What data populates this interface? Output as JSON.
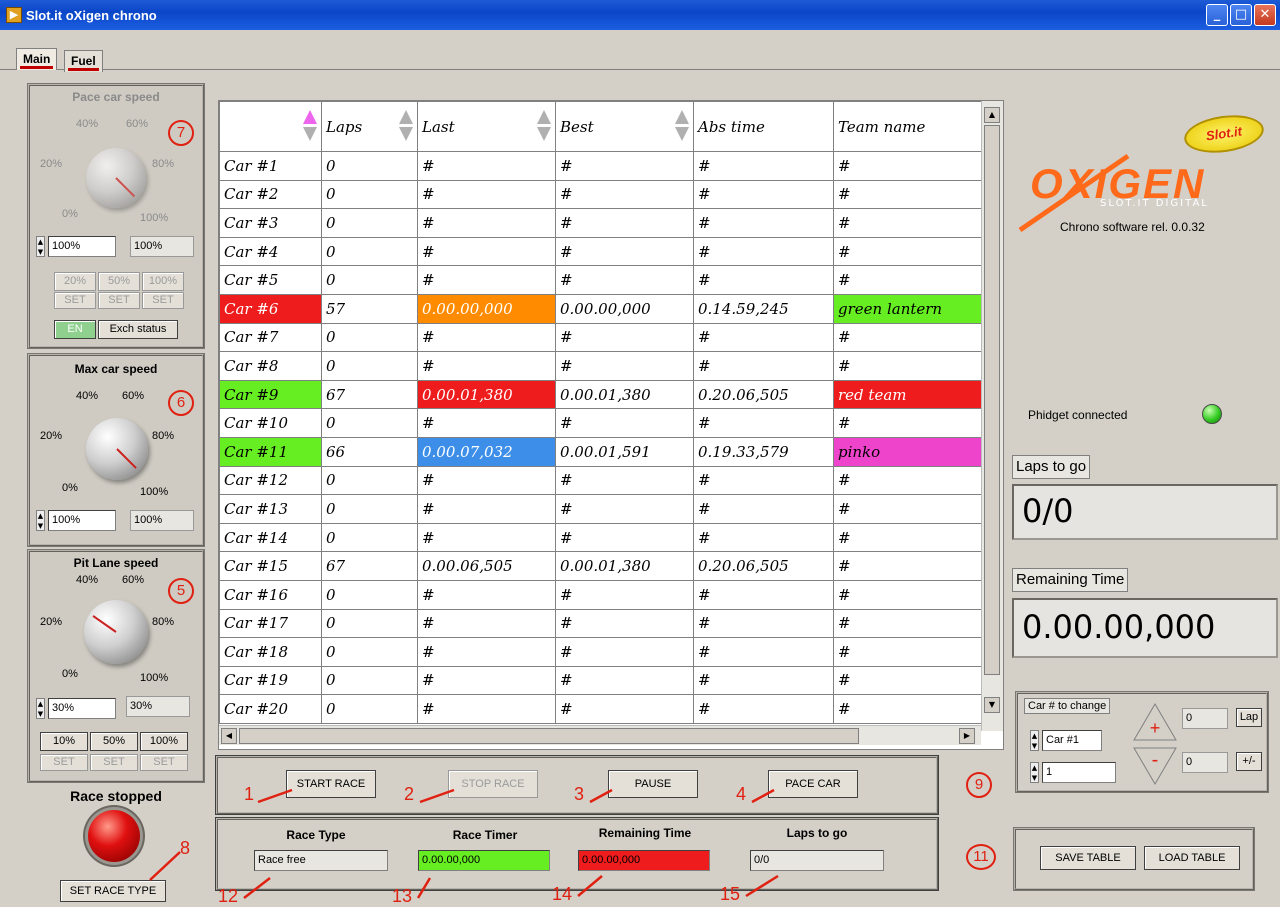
{
  "window": {
    "title": "Slot.it oXigen chrono",
    "icon": "app-icon",
    "controls": [
      "minimize-icon",
      "maximize-icon",
      "close-icon"
    ]
  },
  "tabs": [
    {
      "label": "Main",
      "selected": true
    },
    {
      "label": "Fuel",
      "selected": false
    }
  ],
  "pace_car": {
    "title": "Pace car speed",
    "scale": {
      "p0": "0%",
      "p20": "20%",
      "p40": "40%",
      "p60": "60%",
      "p80": "80%",
      "p100": "100%"
    },
    "value": "100%",
    "readout": "100%",
    "presets": [
      {
        "pct": "20%",
        "set": "SET"
      },
      {
        "pct": "50%",
        "set": "SET"
      },
      {
        "pct": "100%",
        "set": "SET"
      }
    ],
    "en_label": "EN",
    "exch_label": "Exch status",
    "marker": "7",
    "knob_level": 1.0
  },
  "max_car": {
    "title": "Max car speed",
    "scale": {
      "p0": "0%",
      "p20": "20%",
      "p40": "40%",
      "p60": "60%",
      "p80": "80%",
      "p100": "100%"
    },
    "value": "100%",
    "readout": "100%",
    "marker": "6",
    "knob_level": 1.0
  },
  "pit_lane": {
    "title": "Pit Lane speed",
    "scale": {
      "p0": "0%",
      "p20": "20%",
      "p40": "40%",
      "p60": "60%",
      "p80": "80%",
      "p100": "100%"
    },
    "value": "30%",
    "readout": "30%",
    "presets": [
      {
        "pct": "10%",
        "set": "SET"
      },
      {
        "pct": "50%",
        "set": "SET"
      },
      {
        "pct": "100%",
        "set": "SET"
      }
    ],
    "marker": "5",
    "knob_level": 0.3
  },
  "race_status": {
    "label": "Race stopped",
    "led_color": "#e01010",
    "set_race_type_label": "SET RACE TYPE",
    "marker": "8"
  },
  "table": {
    "columns": [
      "",
      "Laps",
      "Last",
      "Best",
      "Abs time",
      "Team name"
    ],
    "rows": [
      {
        "car": "Car #1",
        "laps": "0",
        "last": "#",
        "best": "#",
        "abs": "#",
        "team": "#",
        "car_bg": "",
        "last_bg": "",
        "team_bg": ""
      },
      {
        "car": "Car #2",
        "laps": "0",
        "last": "#",
        "best": "#",
        "abs": "#",
        "team": "#",
        "car_bg": "",
        "last_bg": "",
        "team_bg": ""
      },
      {
        "car": "Car #3",
        "laps": "0",
        "last": "#",
        "best": "#",
        "abs": "#",
        "team": "#",
        "car_bg": "",
        "last_bg": "",
        "team_bg": ""
      },
      {
        "car": "Car #4",
        "laps": "0",
        "last": "#",
        "best": "#",
        "abs": "#",
        "team": "#",
        "car_bg": "",
        "last_bg": "",
        "team_bg": ""
      },
      {
        "car": "Car #5",
        "laps": "0",
        "last": "#",
        "best": "#",
        "abs": "#",
        "team": "#",
        "car_bg": "",
        "last_bg": "",
        "team_bg": ""
      },
      {
        "car": "Car #6",
        "laps": "57",
        "last": "0.00.00,000",
        "best": "0.00.00,000",
        "abs": "0.14.59,245",
        "team": "green lantern",
        "car_bg": "#ee1c1c",
        "last_bg": "#ff8c00",
        "team_bg": "#66ee22"
      },
      {
        "car": "Car #7",
        "laps": "0",
        "last": "#",
        "best": "#",
        "abs": "#",
        "team": "#",
        "car_bg": "",
        "last_bg": "",
        "team_bg": ""
      },
      {
        "car": "Car #8",
        "laps": "0",
        "last": "#",
        "best": "#",
        "abs": "#",
        "team": "#",
        "car_bg": "",
        "last_bg": "",
        "team_bg": ""
      },
      {
        "car": "Car #9",
        "laps": "67",
        "last": "0.00.01,380",
        "best": "0.00.01,380",
        "abs": "0.20.06,505",
        "team": "red team",
        "car_bg": "#66ee22",
        "last_bg": "#ee1c1c",
        "team_bg": "#ee1c1c"
      },
      {
        "car": "Car #10",
        "laps": "0",
        "last": "#",
        "best": "#",
        "abs": "#",
        "team": "#",
        "car_bg": "",
        "last_bg": "",
        "team_bg": ""
      },
      {
        "car": "Car #11",
        "laps": "66",
        "last": "0.00.07,032",
        "best": "0.00.01,591",
        "abs": "0.19.33,579",
        "team": "pinko",
        "car_bg": "#66ee22",
        "last_bg": "#3c8ee8",
        "team_bg": "#ee44cc"
      },
      {
        "car": "Car #12",
        "laps": "0",
        "last": "#",
        "best": "#",
        "abs": "#",
        "team": "#",
        "car_bg": "",
        "last_bg": "",
        "team_bg": ""
      },
      {
        "car": "Car #13",
        "laps": "0",
        "last": "#",
        "best": "#",
        "abs": "#",
        "team": "#",
        "car_bg": "",
        "last_bg": "",
        "team_bg": ""
      },
      {
        "car": "Car #14",
        "laps": "0",
        "last": "#",
        "best": "#",
        "abs": "#",
        "team": "#",
        "car_bg": "",
        "last_bg": "",
        "team_bg": ""
      },
      {
        "car": "Car #15",
        "laps": "67",
        "last": "0.00.06,505",
        "best": "0.00.01,380",
        "abs": "0.20.06,505",
        "team": "#",
        "car_bg": "",
        "last_bg": "",
        "team_bg": ""
      },
      {
        "car": "Car #16",
        "laps": "0",
        "last": "#",
        "best": "#",
        "abs": "#",
        "team": "#",
        "car_bg": "",
        "last_bg": "",
        "team_bg": ""
      },
      {
        "car": "Car #17",
        "laps": "0",
        "last": "#",
        "best": "#",
        "abs": "#",
        "team": "#",
        "car_bg": "",
        "last_bg": "",
        "team_bg": ""
      },
      {
        "car": "Car #18",
        "laps": "0",
        "last": "#",
        "best": "#",
        "abs": "#",
        "team": "#",
        "car_bg": "",
        "last_bg": "",
        "team_bg": ""
      },
      {
        "car": "Car #19",
        "laps": "0",
        "last": "#",
        "best": "#",
        "abs": "#",
        "team": "#",
        "car_bg": "",
        "last_bg": "",
        "team_bg": ""
      },
      {
        "car": "Car #20",
        "laps": "0",
        "last": "#",
        "best": "#",
        "abs": "#",
        "team": "#",
        "car_bg": "",
        "last_bg": "",
        "team_bg": ""
      }
    ]
  },
  "controls": {
    "start": {
      "label": "START RACE",
      "marker": "1"
    },
    "stop": {
      "label": "STOP RACE",
      "marker": "2"
    },
    "pause": {
      "label": "PAUSE",
      "marker": "3"
    },
    "pace": {
      "label": "PACE CAR",
      "marker": "4"
    }
  },
  "info": {
    "race_type": {
      "label": "Race Type",
      "value": "Race free",
      "marker": "12",
      "bg": "#e8e6e0"
    },
    "race_timer": {
      "label": "Race Timer",
      "value": "0.00.00,000",
      "marker": "13",
      "bg": "#66ee22"
    },
    "remaining": {
      "label": "Remaining Time",
      "value": "0.00.00,000",
      "marker": "14",
      "bg": "#ee1c1c"
    },
    "laps_to_go": {
      "label": "Laps to go",
      "value": "0/0",
      "marker": "15",
      "bg": "#e8e6e0"
    }
  },
  "right": {
    "brand_badge": "Slot.it",
    "logo_text": "OXIGEN",
    "logo_sub": "SLOT.IT DIGITAL",
    "version": "Chrono software rel. 0.0.32",
    "phidget_label": "Phidget connected",
    "phidget_led": "#33cc22",
    "laps_to_go_caption": "Laps to go",
    "laps_to_go_value": "0/0",
    "remaining_caption": "Remaining Time",
    "remaining_value": "0.00.00,000"
  },
  "car_change": {
    "caption": "Car # to change",
    "car_value": "Car #1",
    "num_value": "1",
    "plus": "+",
    "minus": "-",
    "lap_value": "0",
    "lap_label": "Lap",
    "pm_value": "0",
    "pm_label": "+/-",
    "marker": "9"
  },
  "table_io": {
    "save_label": "SAVE TABLE",
    "load_label": "LOAD TABLE",
    "marker": "11"
  }
}
